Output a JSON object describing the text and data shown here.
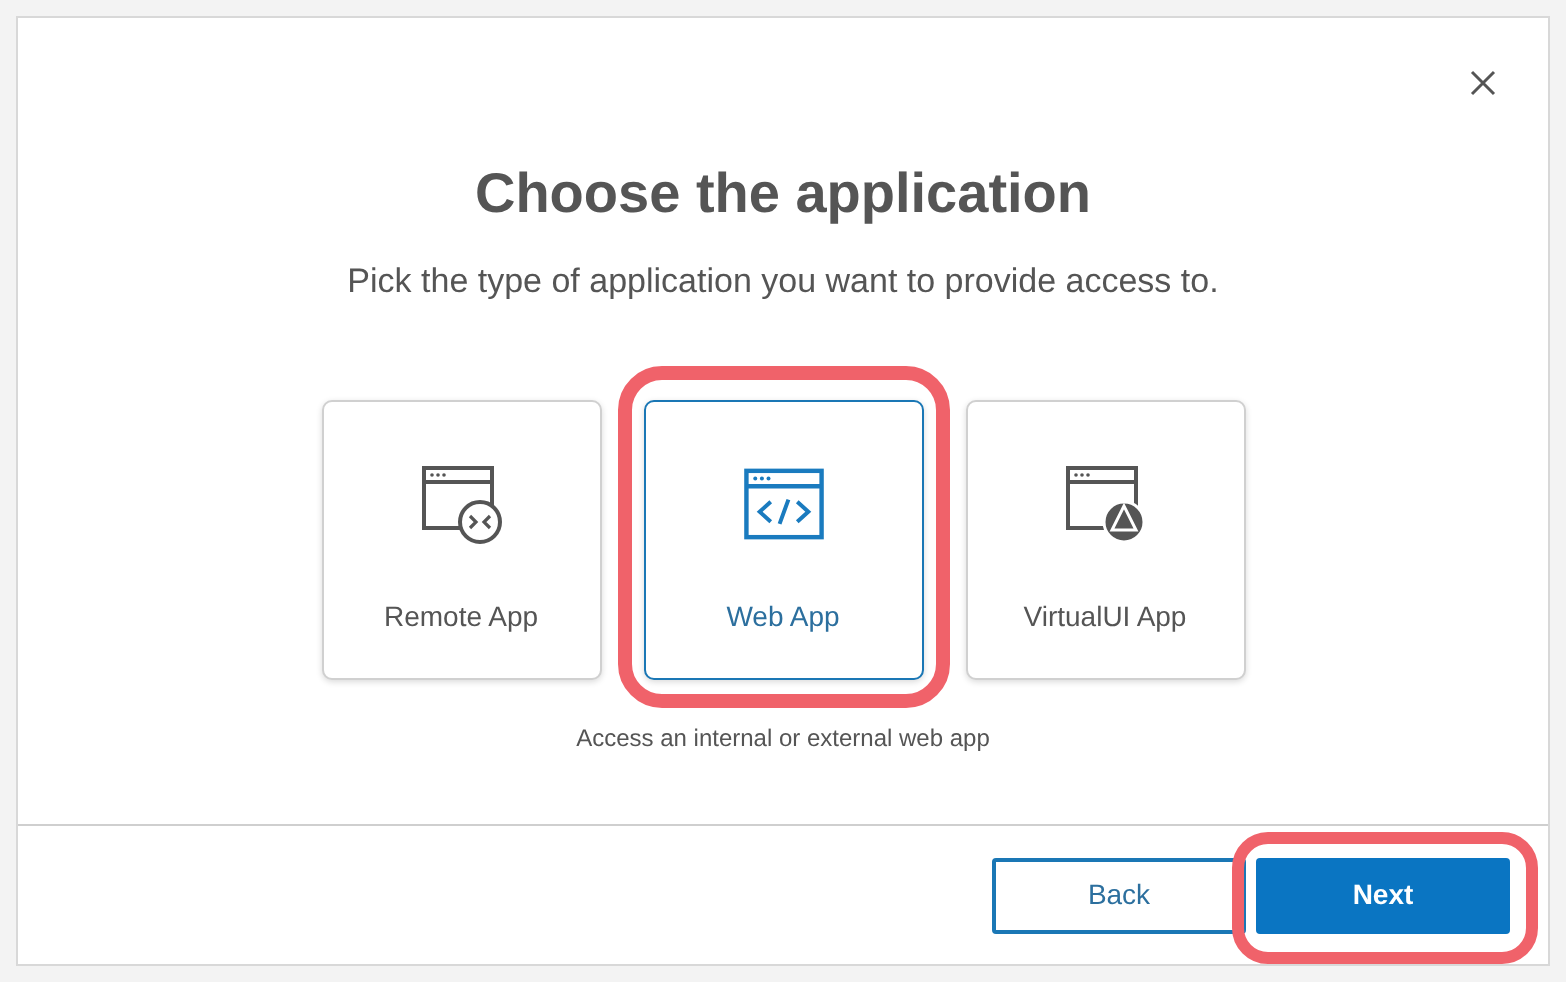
{
  "dialog": {
    "title": "Choose the application",
    "subtitle": "Pick the type of application you want to provide access to.",
    "options": [
      {
        "kind": "remote",
        "label": "Remote App",
        "selected": false,
        "highlighted": false
      },
      {
        "kind": "web",
        "label": "Web App",
        "selected": true,
        "highlighted": true
      },
      {
        "kind": "virtualui",
        "label": "VirtualUI App",
        "selected": false,
        "highlighted": false
      }
    ],
    "hint": "Access an internal or external web app",
    "buttons": [
      {
        "kind": "secondary",
        "label": "Back",
        "highlighted": false
      },
      {
        "kind": "primary",
        "label": "Next",
        "highlighted": true
      }
    ]
  }
}
